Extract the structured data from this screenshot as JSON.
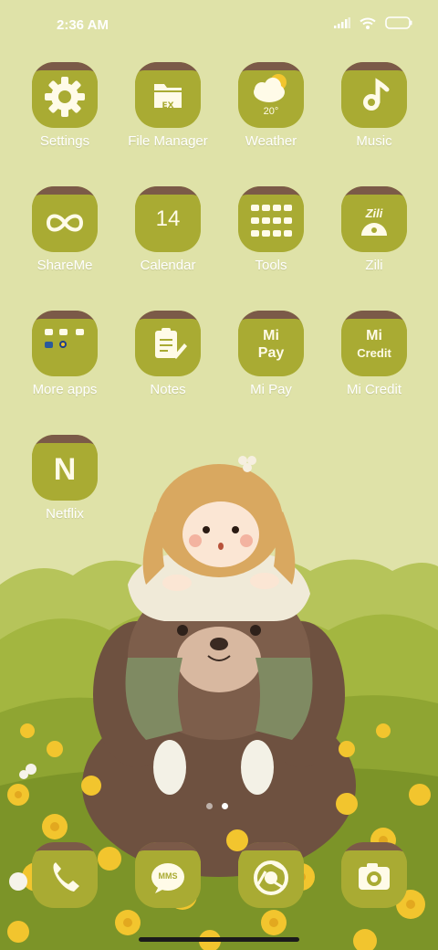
{
  "status_bar": {
    "time": "2:36 AM",
    "icons": [
      "signal-icon",
      "wifi-icon",
      "battery-icon"
    ]
  },
  "apps": [
    {
      "label": "Settings",
      "icon": "gear-icon"
    },
    {
      "label": "File Manager",
      "icon": "folder-icon",
      "glyph_text": "EX"
    },
    {
      "label": "Weather",
      "icon": "weather-icon",
      "glyph_text": "20°"
    },
    {
      "label": "Music",
      "icon": "music-note-icon"
    },
    {
      "label": "ShareMe",
      "icon": "infinity-icon"
    },
    {
      "label": "Calendar",
      "icon": "calendar-icon",
      "glyph_text": "14"
    },
    {
      "label": "Tools",
      "icon": "tools-folder-icon"
    },
    {
      "label": "Zili",
      "icon": "zili-icon",
      "glyph_text": "Zili"
    },
    {
      "label": "More apps",
      "icon": "apps-folder-icon"
    },
    {
      "label": "Notes",
      "icon": "notes-icon"
    },
    {
      "label": "Mi Pay",
      "icon": "mi-pay-icon",
      "glyph_text_1": "Mi",
      "glyph_text_2": "Pay"
    },
    {
      "label": "Mi Credit",
      "icon": "mi-credit-icon",
      "glyph_text_1": "Mi",
      "glyph_text_2": "Credit"
    },
    {
      "label": "Netflix",
      "icon": "netflix-icon",
      "glyph_text": "N"
    }
  ],
  "dock": [
    {
      "icon": "phone-icon"
    },
    {
      "icon": "messages-icon",
      "glyph_text": "MMS"
    },
    {
      "icon": "browser-icon"
    },
    {
      "icon": "camera-icon"
    }
  ],
  "pages": {
    "count": 2,
    "active": 2
  },
  "colors": {
    "background": "#dfe2a8",
    "icon_fill": "#a9ab33",
    "icon_cap": "#7b5a48",
    "label_text": "#ffffff",
    "bear": "#7d5e4b",
    "flowers": "#f2c52e",
    "grass": "#9fb23a"
  }
}
